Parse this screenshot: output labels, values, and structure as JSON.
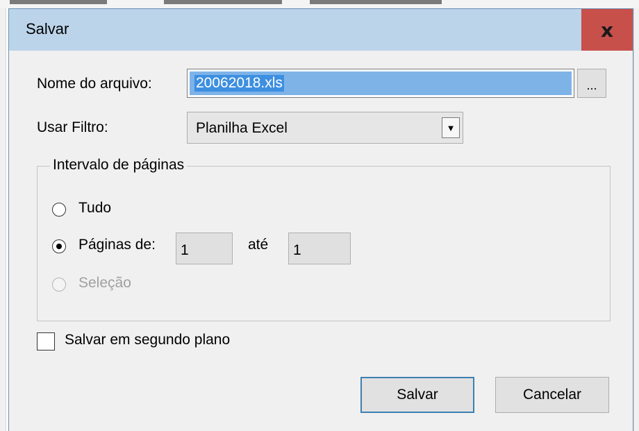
{
  "dialog": {
    "title": "Salvar",
    "close_icon": "close-x-icon",
    "close_label": "x"
  },
  "filename": {
    "label": "Nome do arquivo:",
    "value": "20062018.xls",
    "browse_label": "..."
  },
  "filter": {
    "label": "Usar Filtro:",
    "value": "Planilha Excel",
    "arrow": "▼"
  },
  "page_range": {
    "legend": "Intervalo de páginas",
    "all_label": "Tudo",
    "pages_label": "Páginas de:",
    "from_value": "1",
    "to_label": "até",
    "to_value": "1",
    "selection_label": "Seleção",
    "selected_option": "pages"
  },
  "background_save": {
    "label": "Salvar em segundo plano",
    "checked": false
  },
  "buttons": {
    "save": "Salvar",
    "cancel": "Cancelar"
  },
  "colors": {
    "titlebar": "#bcd4ea",
    "close_button": "#c7504b",
    "selection_highlight": "#7eb3e8"
  }
}
